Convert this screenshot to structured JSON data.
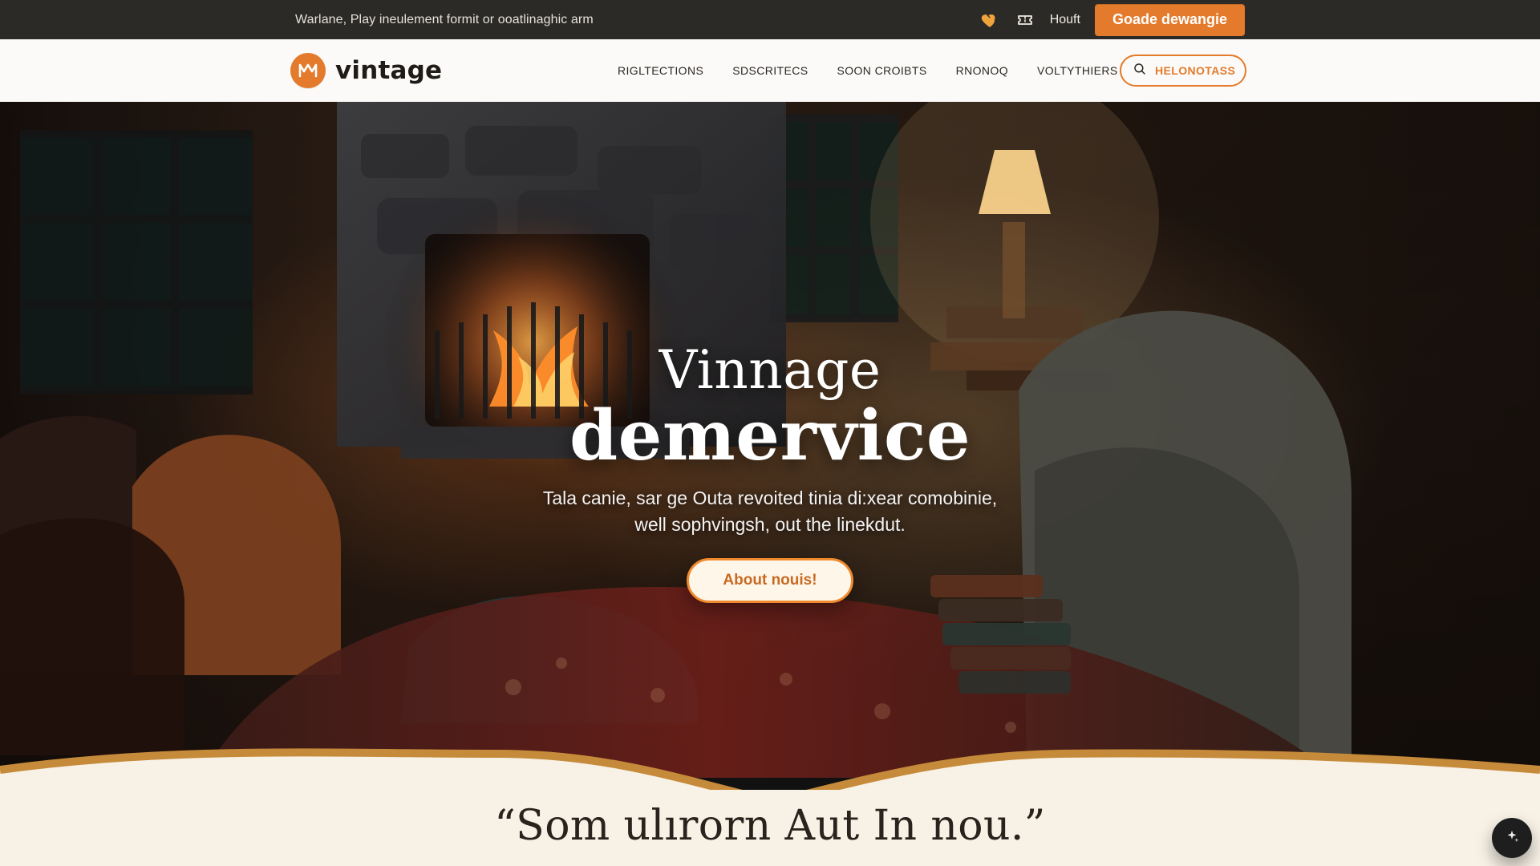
{
  "colors": {
    "accent": "#E47A2B",
    "topbar_bg": "#2B2A27",
    "nav_bg": "#FBFAF8",
    "cream": "#F7F1E6"
  },
  "topbar": {
    "message": "Warlane, Play ineulement formit or ooatlinaghic arm",
    "icons": [
      "heart-icon",
      "ticket-icon"
    ],
    "link_text": "Houft",
    "cta_label": "Goade dewangie"
  },
  "nav": {
    "brand_name": "vintage",
    "links": [
      "RIGLTECTIONS",
      "SDSCRITECS",
      "SOON CROIBTS",
      "RNONOQ",
      "VOLTYTHIERS"
    ],
    "search_label": "HELONOTASS"
  },
  "hero": {
    "kicker": "Vinnage",
    "title": "demervice",
    "subtitle_line1": "Tala canie, sar ge Outa revoited tinia di:xear comobinie,",
    "subtitle_line2": "well sophvingsh, out the linekdut.",
    "cta_label": "About nouis!"
  },
  "lower": {
    "quote": "“Som ulırorn Aut In nou.”"
  },
  "fab": {
    "icon": "sparkle-icon"
  }
}
